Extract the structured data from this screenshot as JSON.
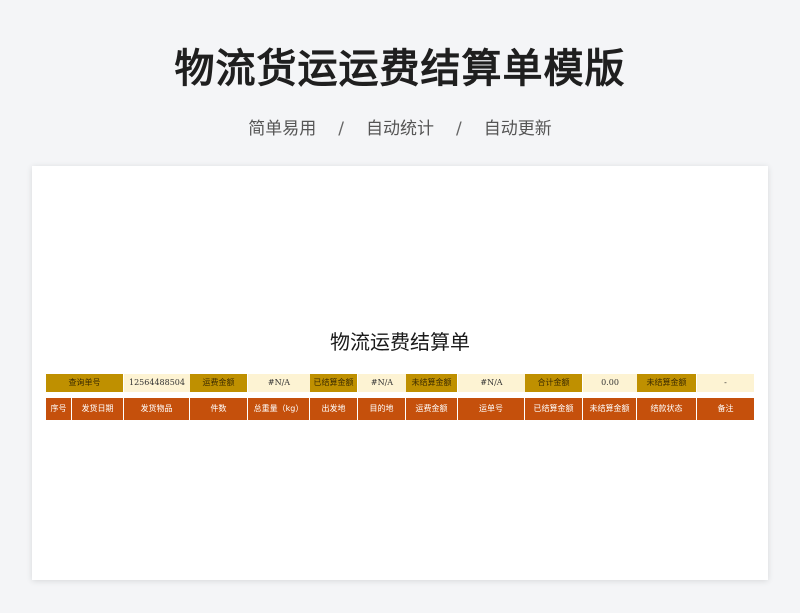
{
  "hero": {
    "title": "物流货运运费结算单模版",
    "features": [
      "简单易用",
      "自动统计",
      "自动更新"
    ],
    "separator": "/"
  },
  "sheet": {
    "title": "物流运费结算单",
    "query_row": [
      {
        "kind": "label",
        "text": "查询单号"
      },
      {
        "kind": "value",
        "text": "12564488504"
      },
      {
        "kind": "label",
        "text": "运费金额"
      },
      {
        "kind": "value",
        "text": "#N/A"
      },
      {
        "kind": "label",
        "text": "已结算金额"
      },
      {
        "kind": "value",
        "text": "#N/A"
      },
      {
        "kind": "label",
        "text": "未结算金额"
      },
      {
        "kind": "value",
        "text": "#N/A"
      },
      {
        "kind": "label",
        "text": "合计金额"
      },
      {
        "kind": "value",
        "text": "0.00"
      },
      {
        "kind": "label",
        "text": "未结算金额"
      },
      {
        "kind": "value",
        "text": "-"
      }
    ],
    "columns": [
      "序号",
      "发货日期",
      "发货物品",
      "件数",
      "总重量（kg）",
      "出发地",
      "目的地",
      "运费金额",
      "运单号",
      "已结算金额",
      "未结算金额",
      "结款状态",
      "备注"
    ]
  },
  "colors": {
    "label_bg": "#bf9000",
    "value_bg": "#fdf3d3",
    "header_bg": "#c5500c"
  }
}
